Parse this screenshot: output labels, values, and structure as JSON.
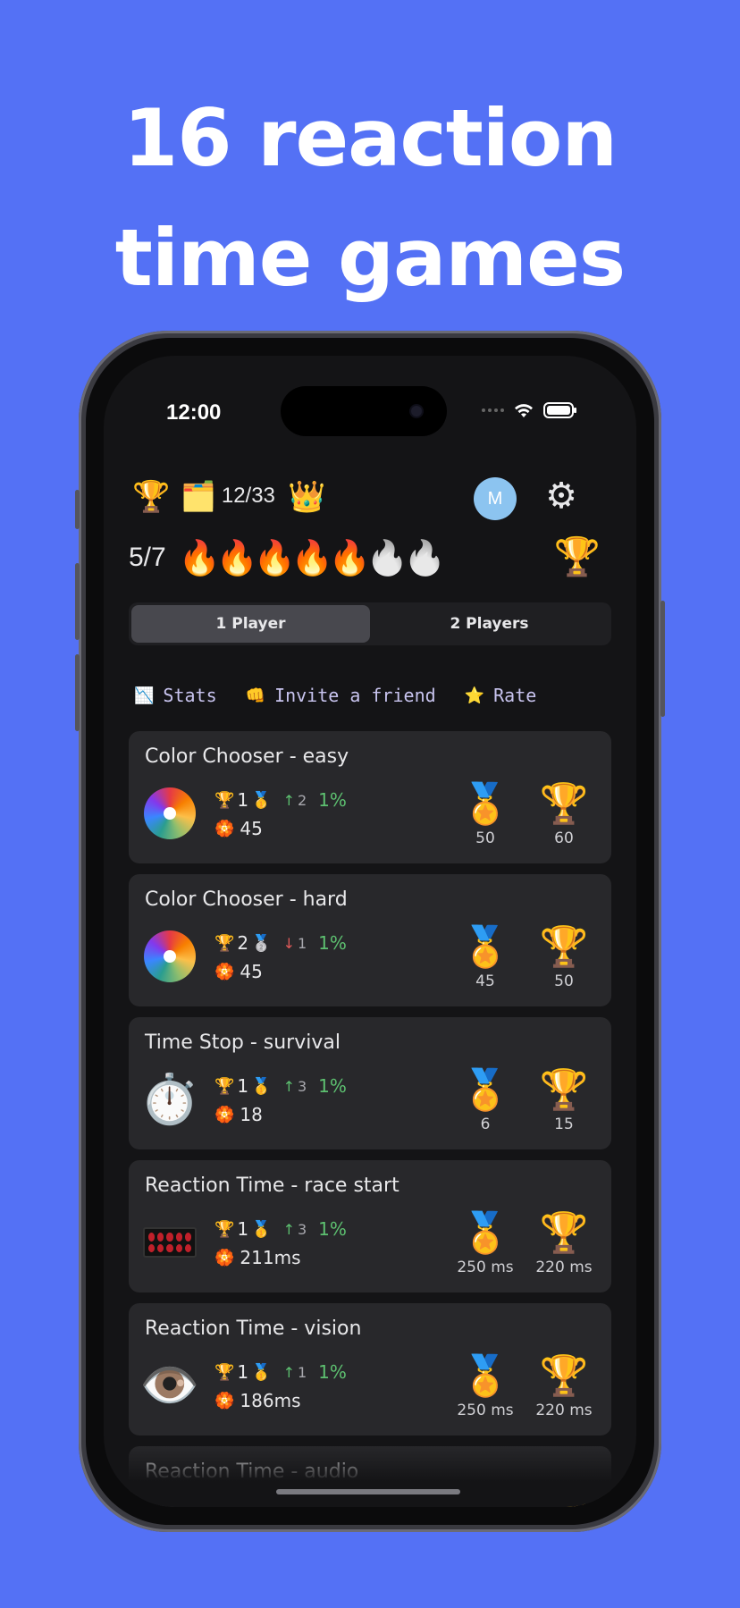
{
  "headline": {
    "line1": "16 reaction",
    "line2": "time games"
  },
  "status_bar": {
    "time": "12:00"
  },
  "toolbar": {
    "trophy_icon": "🏆",
    "cards_icon": "🗂️",
    "cards_count": "12/33",
    "crown_icon": "👑",
    "avatar_initial": "M",
    "settings_icon": "⚙"
  },
  "streak": {
    "count": "5/7",
    "fire_icon": "🔥",
    "days_lit": 5,
    "days_total": 7,
    "badge_icon": "🏆"
  },
  "mode_tabs": [
    {
      "label": "1 Player",
      "active": true
    },
    {
      "label": "2 Players",
      "active": false
    }
  ],
  "links": [
    {
      "icon": "📉",
      "label": "Stats"
    },
    {
      "icon": "👊",
      "label": "Invite a friend"
    },
    {
      "icon": "⭐",
      "label": "Rate"
    }
  ],
  "games": [
    {
      "title": "Color Chooser - easy",
      "icon": "color-wheel",
      "rank": "1",
      "medal": "🥇",
      "trend": "↑",
      "trend_dir": "up",
      "trend_value": "2",
      "percent": "1%",
      "best": "45",
      "medal_award": "🏅",
      "medal_value": "50",
      "trophy_award": "🏆",
      "trophy_value": "60"
    },
    {
      "title": "Color Chooser - hard",
      "icon": "color-wheel",
      "rank": "2",
      "medal": "🥈",
      "trend": "↓",
      "trend_dir": "down",
      "trend_value": "1",
      "percent": "1%",
      "best": "45",
      "medal_award": "🏅",
      "medal_value": "45",
      "trophy_award": "🏆",
      "trophy_value": "50"
    },
    {
      "title": "Time Stop - survival",
      "icon": "⏱️",
      "rank": "1",
      "medal": "🥇",
      "trend": "↑",
      "trend_dir": "up",
      "trend_value": "3",
      "percent": "1%",
      "best": "18",
      "medal_award": "🏅",
      "medal_value": "6",
      "trophy_award": "🏆",
      "trophy_value": "15"
    },
    {
      "title": "Reaction Time - race start",
      "icon": "start-lights",
      "rank": "1",
      "medal": "🥇",
      "trend": "↑",
      "trend_dir": "up",
      "trend_value": "3",
      "percent": "1%",
      "best": "211ms",
      "medal_award": "🏅",
      "medal_value": "250 ms",
      "trophy_award": "🏆",
      "trophy_value": "220 ms"
    },
    {
      "title": "Reaction Time - vision",
      "icon": "👁️",
      "rank": "1",
      "medal": "🥇",
      "trend": "↑",
      "trend_dir": "up",
      "trend_value": "1",
      "percent": "1%",
      "best": "186ms",
      "medal_award": "🏅",
      "medal_value": "250 ms",
      "trophy_award": "🏆",
      "trophy_value": "220 ms"
    },
    {
      "title": "Reaction Time - audio",
      "icon": "",
      "rank": "",
      "medal": "",
      "trend": "",
      "trend_dir": "",
      "trend_value": "",
      "percent": "",
      "best": "",
      "medal_award": "🏅",
      "medal_value": "",
      "trophy_award": "🏆",
      "trophy_value": ""
    }
  ],
  "row_icons": {
    "trophy": "🏆",
    "best": "🏵️"
  }
}
